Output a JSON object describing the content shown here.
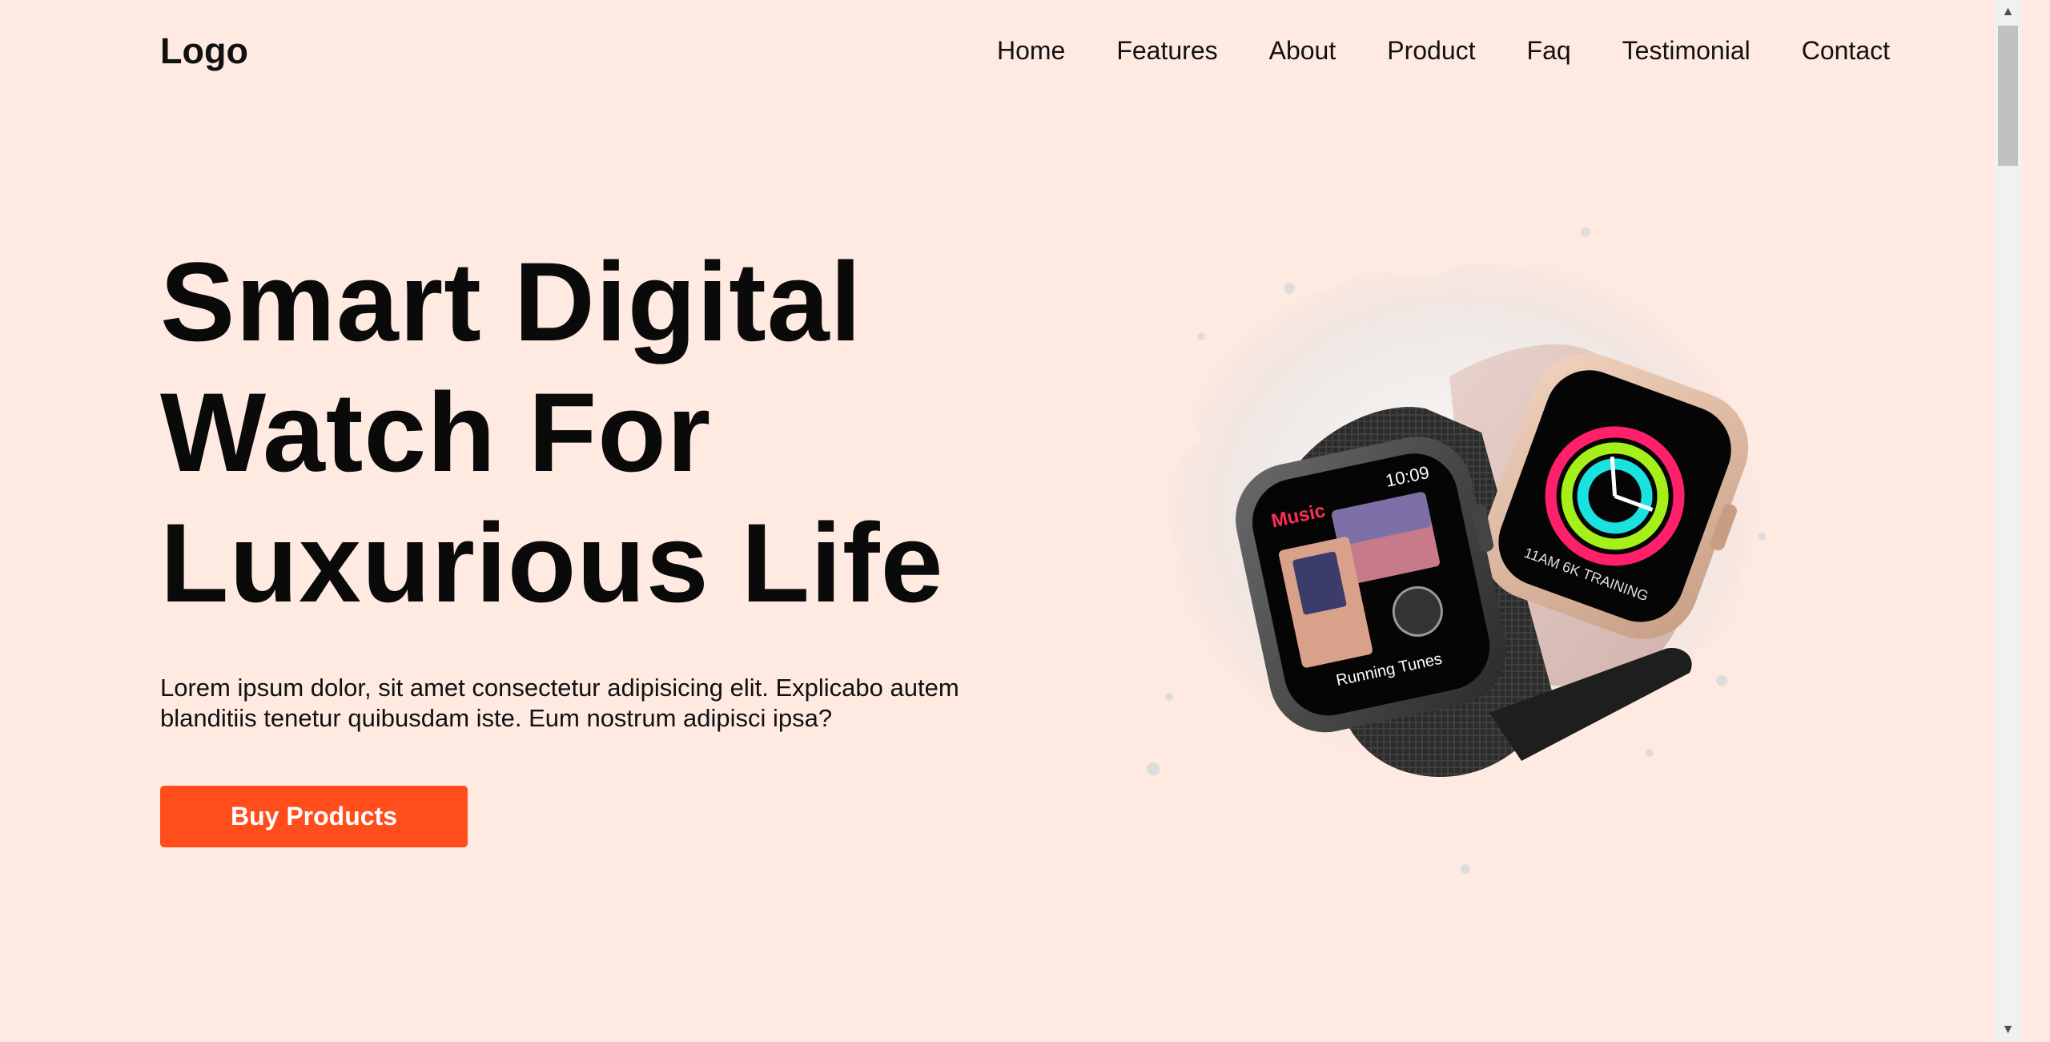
{
  "header": {
    "logo": "Logo",
    "nav": [
      "Home",
      "Features",
      "About",
      "Product",
      "Faq",
      "Testimonial",
      "Contact"
    ]
  },
  "hero": {
    "title_lines": [
      "Smart Digital",
      "Watch For",
      "Luxurious Life"
    ],
    "description": "Lorem ipsum dolor, sit amet consectetur adipisicing elit. Explicabo autem blanditiis tenetur quibusdam iste. Eum nostrum adipisci ipsa?",
    "cta_label": "Buy Products",
    "image": {
      "subject": "two smart watches with water splash",
      "watch_left_time": "10:09",
      "watch_left_app": "Music",
      "watch_left_track": "Running Tunes",
      "watch_right_workout": "11AM 6K TRAINING"
    }
  },
  "colors": {
    "background": "#ffeae1",
    "accent": "#ff4d1c",
    "text": "#0a0a0a"
  }
}
